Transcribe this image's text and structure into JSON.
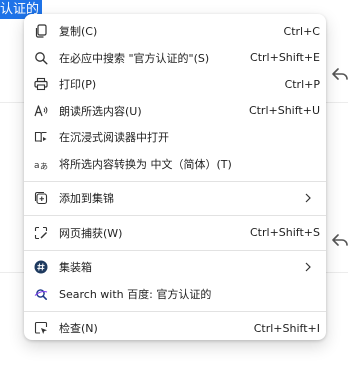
{
  "page": {
    "selected_text": "认证的"
  },
  "menu": {
    "copy": {
      "label": "复制(C)",
      "shortcut": "Ctrl+C"
    },
    "search": {
      "label": "在必应中搜索 \"官方认证的\"(S)",
      "shortcut": "Ctrl+Shift+E"
    },
    "print": {
      "label": "打印(P)",
      "shortcut": "Ctrl+P"
    },
    "read_aloud": {
      "label": "朗读所选内容(U)",
      "shortcut": "Ctrl+Shift+U"
    },
    "immersive": {
      "label": "在沉浸式阅读器中打开"
    },
    "translate": {
      "label": "将所选内容转换为 中文（简体）(T)"
    },
    "collections": {
      "label": "添加到集锦"
    },
    "web_capture": {
      "label": "网页捕获(W)",
      "shortcut": "Ctrl+Shift+S"
    },
    "toolbox": {
      "label": "集装箱"
    },
    "search_baidu": {
      "label": "Search with 百度: 官方认证的"
    },
    "inspect": {
      "label": "检查(N)",
      "shortcut": "Ctrl+Shift+I"
    }
  }
}
